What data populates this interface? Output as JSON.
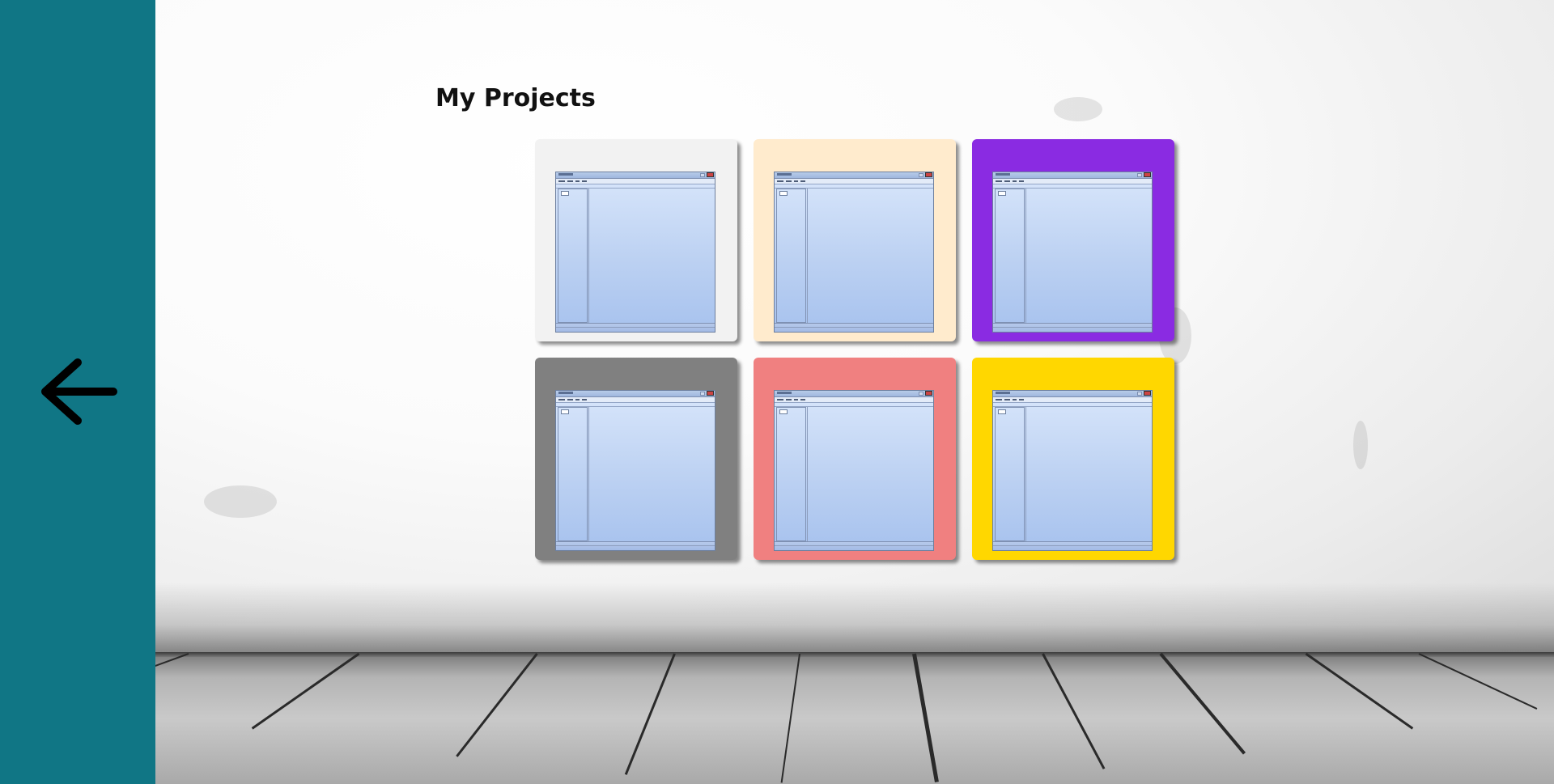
{
  "page": {
    "title": "My Projects"
  },
  "sidebar": {
    "background": "#107685",
    "back_button": {
      "icon": "arrow-left-icon"
    }
  },
  "projects": [
    {
      "color": "#f2f2f2"
    },
    {
      "color": "#ffebcd"
    },
    {
      "color": "#8a2be2"
    },
    {
      "color": "#808080"
    },
    {
      "color": "#f08080"
    },
    {
      "color": "#ffd700"
    }
  ]
}
